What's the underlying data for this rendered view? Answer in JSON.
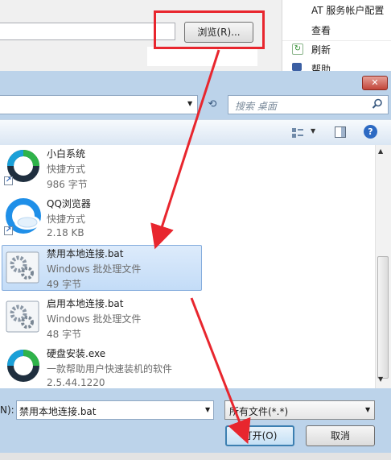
{
  "background": {
    "browse_label": "浏览(R)...",
    "menu": {
      "item1": "AT 服务帐户配置",
      "item2": "查看",
      "item3": "刷新",
      "item4": "帮助"
    }
  },
  "dialog": {
    "search_placeholder": "搜索 桌面",
    "files": [
      {
        "name": "小白系统",
        "line2": "快捷方式",
        "line3": "986 字节",
        "icon": "xiaobai-icon"
      },
      {
        "name": "QQ浏览器",
        "line2": "快捷方式",
        "line3": "2.18 KB",
        "icon": "qqbrowser-icon"
      },
      {
        "name": "禁用本地连接.bat",
        "line2": "Windows 批处理文件",
        "line3": "49 字节",
        "icon": "batch-file-icon",
        "selected": true
      },
      {
        "name": "启用本地连接.bat",
        "line2": "Windows 批处理文件",
        "line3": "48 字节",
        "icon": "batch-file-icon"
      },
      {
        "name": "硬盘安装.exe",
        "line2": "一款帮助用户快速装机的软件",
        "line3": "2.5.44.1220",
        "icon": "installer-icon"
      }
    ],
    "filename_label": "N):",
    "filename_value": "禁用本地连接.bat",
    "filetype_value": "所有文件(*.*)",
    "open_label": "打开(O)",
    "cancel_label": "取消"
  },
  "colors": {
    "highlight": "#e8262e",
    "selection": "#c3dcf7"
  }
}
